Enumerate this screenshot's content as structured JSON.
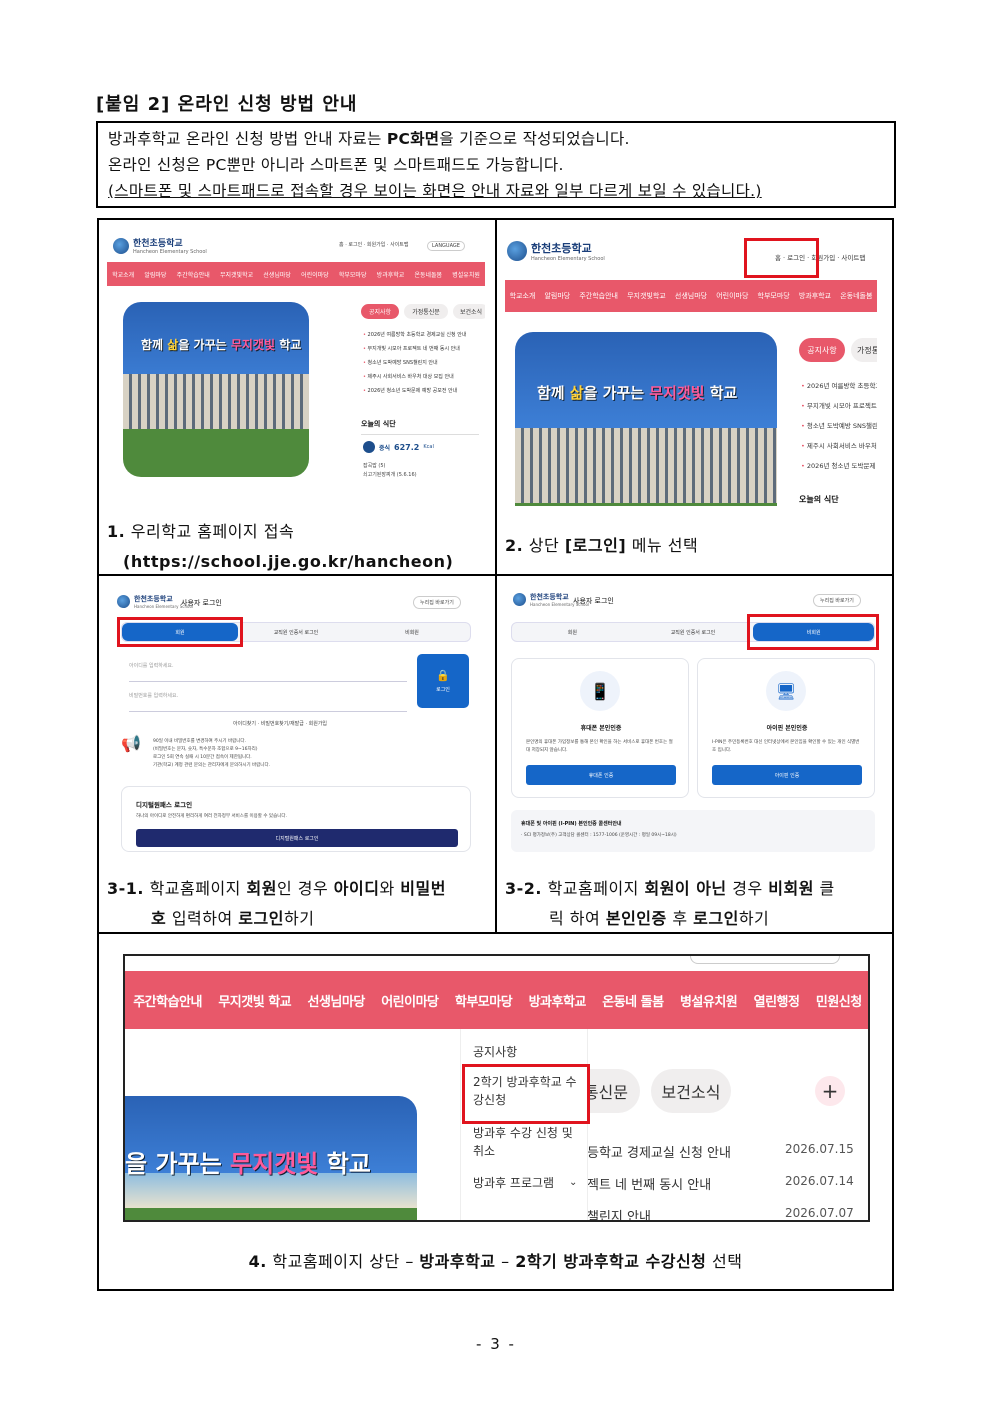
{
  "title": "[붙임 2] 온라인 신청 방법 안내",
  "intro": {
    "line1_pre": "방과후학교 온라인 신청 방법 안내 자료는 ",
    "line1_bold": "PC화면",
    "line1_post": "을 기준으로 작성되었습니다.",
    "line2": "온라인 신청은 PC뿐만 아니라 스마트폰 및 스마트패드도 가능합니다.",
    "line3": "(스마트폰 및 스마트패드로 접속할 경우 보이는 화면은 안내 자료와 일부 다르게 보일 수 있습니다.)"
  },
  "site": {
    "school_name": "한천초등학교",
    "school_sub": "Hancheon Elementary School",
    "top_links": "홈 · 로그인 · 회원가입 · 사이트맵",
    "language": "LANGUAGE",
    "nav_small": [
      "학교소개",
      "알림마당",
      "주간학습안내",
      "무지갯빛학교",
      "선생님마당",
      "어린이마당",
      "학부모마당",
      "방과후학교",
      "온동네돌봄",
      "병설유치원"
    ],
    "banner_pre": "함께 ",
    "banner_hl1": "삶",
    "banner_mid": "을 가꾸는 ",
    "banner_hl2": "무지갯빛",
    "banner_post": " 학교",
    "tabs": [
      "공지사항",
      "가정통신문",
      "보건소식"
    ],
    "news": [
      "2026년 여름방학 초등학교 경제교실 신청 안내",
      "무지개빛 시모아 프로젝트 네 번째 동시 안내",
      "청소년 도박예방 SNS챌린지 안내",
      "제주시 사회서비스 바우처 대상 모집 안내",
      "2026년 청소년 도박문제 예방 공모전 안내"
    ],
    "meal_title": "오늘의 식단",
    "meal_label": "중식",
    "meal_kcal": "627.2",
    "meal_unit": "Kcal",
    "meal_items": "잡곡밥 (5)\n쇠고기된장찌개 (5.6.16)"
  },
  "login": {
    "title": "사용자 로그인",
    "home_link": "누리집 바로가기",
    "tabs": [
      "회원",
      "교직원 인증서 로그인",
      "비회원"
    ],
    "id_placeholder": "아이디를 입력하세요.",
    "pw_placeholder": "비밀번호를 입력하세요.",
    "login_button": "로그인",
    "links": "아이디찾기 · 비밀번호찾기/재발급 · 회원가입",
    "notice": "90일 이내 비밀번호를 변경하여 주시기 바랍니다.\n(비밀번호는 문자, 숫자, 특수문자 조합으로 9~16자리)\n로그인 5회 연속 실패 시 10분간 접속이 제한됩니다.\n기관(학교) 계정 관련 문의는 관리자에게 문의하시기 바랍니다.",
    "digital_title": "디지털원패스 로그인",
    "digital_desc": "하나의 아이디로 안전하게 편리하게 여러 전자정부 서비스를 이용할 수 있습니다.",
    "digital_button": "디지털원패스 로그인",
    "phone_title": "휴대폰 본인인증",
    "phone_desc": "본인명의 휴대폰 가입정보를 통해 본인 확인을 하는 서비스로 휴대폰 번호는 절대 저장되지 않습니다.",
    "phone_button": "휴대폰 인증",
    "ipin_title": "아이핀 본인인증",
    "ipin_desc": "I-PIN은 주민등록번호 대신 인터넷상에서 본인임을 확인할 수 있는 개인 식별번호 입니다.",
    "ipin_button": "아이핀 인증",
    "help_title": "휴대폰 및 아이핀 (I-PIN) 본인인증 콜센터안내",
    "help_desc": "· SCI 평가정보(주) 고객상담 콜센터 : 1577-1006 (운영시간 : 평일 09시~18시)"
  },
  "menu_shot": {
    "nav": [
      "주간학습안내",
      "무지갯빛 학교",
      "선생님마당",
      "어린이마당",
      "학부모마당",
      "방과후학교",
      "온동네 돌봄",
      "병설유치원",
      "열린행정",
      "민원신청"
    ],
    "dropdown": [
      "공지사항",
      "2학기 방과후학교 수강신청",
      "방과후 수강 신청 및 취소",
      "방과후 프로그램"
    ],
    "tabs": [
      "통신문",
      "보건소식"
    ],
    "plus": "+",
    "news": [
      {
        "text": "등학교 경제교실 신청 안내",
        "date": "2026.07.15"
      },
      {
        "text": "젝트 네 번째 동시 안내",
        "date": "2026.07.14"
      },
      {
        "text": "챌린지 안내",
        "date": "2026.07.07"
      }
    ],
    "banner_text": "을 가꾸는 ",
    "banner_hl": "무지갯빛",
    "banner_post": " 학교"
  },
  "captions": {
    "c1_num": "1.",
    "c1_text": " 우리학교 홈페이지 접속",
    "c1_url": "(https://school.jje.go.kr/hancheon)",
    "c2_num": "2.",
    "c2_text1": " 상단 ",
    "c2_bold": "[로그인]",
    "c2_text2": " 메뉴 선택",
    "c3_num": "3-1.",
    "c3_t1": " 학교홈페이지 ",
    "c3_b1": "회원",
    "c3_t2": "인 경우 ",
    "c3_b2": "아이디",
    "c3_t3": "와 ",
    "c3_b3": "비밀번",
    "c3_b4": "호",
    "c3_t4": " 입력하여 ",
    "c3_b5": "로그인",
    "c3_t5": "하기",
    "c4_num": "3-2.",
    "c4_t1": " 학교홈페이지 ",
    "c4_b1": "회원이 아닌",
    "c4_t2": " 경우 ",
    "c4_b2": "비회원",
    "c4_t3": " 클",
    "c4_t4": "릭 하여 ",
    "c4_b3": "본인인증",
    "c4_t5": " 후 ",
    "c4_b4": "로그인",
    "c4_t6": "하기",
    "c5_num": "4.",
    "c5_t1": " 학교홈페이지 상단 – ",
    "c5_b1": "방과후학교",
    "c5_t2": " – ",
    "c5_b2": "2학기 방과후학교 수강신청",
    "c5_t3": " 선택"
  },
  "page_number": "- 3 -"
}
